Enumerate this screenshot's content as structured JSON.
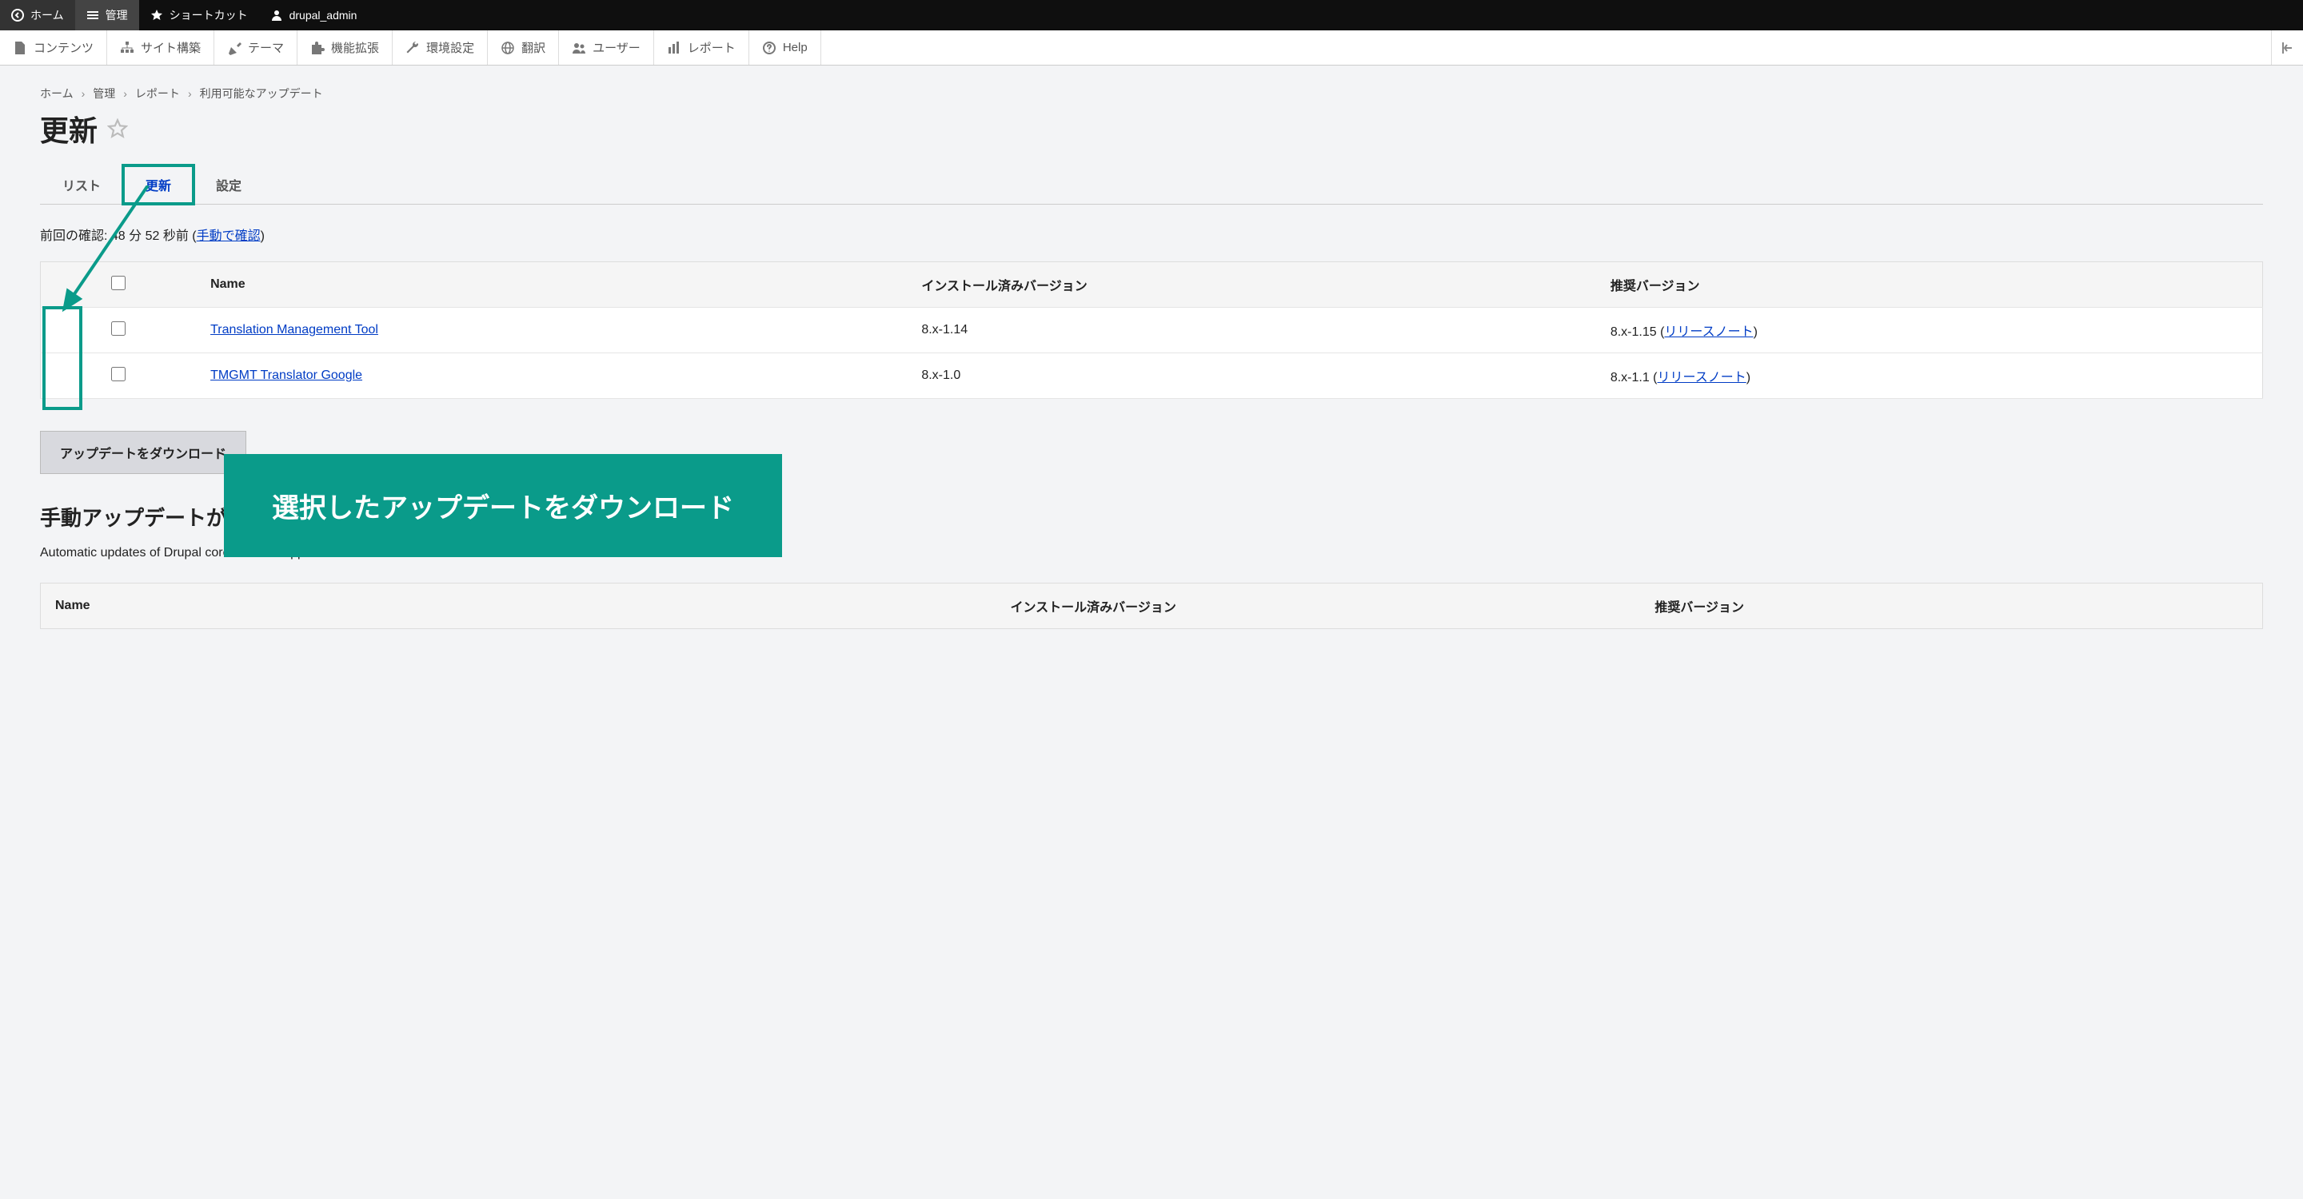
{
  "toolbar_top": {
    "home": "ホーム",
    "manage": "管理",
    "shortcuts": "ショートカット",
    "user": "drupal_admin"
  },
  "toolbar_admin": {
    "content": "コンテンツ",
    "structure": "サイト構築",
    "appearance": "テーマ",
    "extend": "機能拡張",
    "configuration": "環境設定",
    "translate": "翻訳",
    "people": "ユーザー",
    "reports": "レポート",
    "help": "Help"
  },
  "breadcrumb": {
    "home": "ホーム",
    "manage": "管理",
    "reports": "レポート",
    "available_updates": "利用可能なアップデート"
  },
  "page_title": "更新",
  "tabs": {
    "list": "リスト",
    "update": "更新",
    "settings": "設定"
  },
  "last_check": {
    "prefix": "前回の確認: 48 分 52 秒前 (",
    "link": "手動で確認",
    "suffix": ")"
  },
  "table": {
    "headers": {
      "name": "Name",
      "installed": "インストール済みバージョン",
      "recommended": "推奨バージョン"
    },
    "rows": [
      {
        "name": "Translation Management Tool",
        "installed": "8.x-1.14",
        "recommended_prefix": "8.x-1.15 (",
        "release_notes": "リリースノート",
        "recommended_suffix": ")"
      },
      {
        "name": "TMGMT Translator Google",
        "installed": "8.x-1.0",
        "recommended_prefix": "8.x-1.1 (",
        "release_notes": "リリースノート",
        "recommended_suffix": ")"
      }
    ]
  },
  "download_button": "アップデートをダウンロード",
  "manual_heading": "手動アップデートが",
  "manual_note": "Automatic updates of Drupal core are not supported at this time.",
  "manual_table": {
    "headers": {
      "name": "Name",
      "installed": "インストール済みバージョン",
      "recommended": "推奨バージョン"
    }
  },
  "callout_text": "選択したアップデートをダウンロード"
}
